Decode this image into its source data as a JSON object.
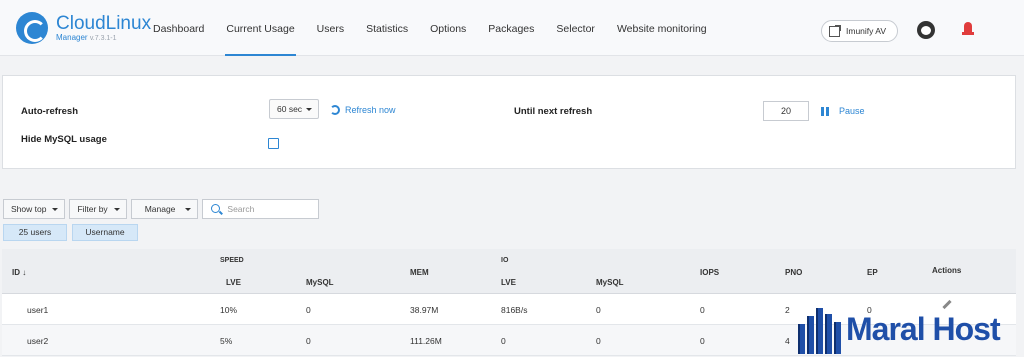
{
  "brand": {
    "name": "CloudLinux",
    "sub": "Manager",
    "version": "v.7.3.1-1"
  },
  "nav": [
    {
      "label": "Dashboard"
    },
    {
      "label": "Current Usage"
    },
    {
      "label": "Users"
    },
    {
      "label": "Statistics"
    },
    {
      "label": "Options"
    },
    {
      "label": "Packages"
    },
    {
      "label": "Selector"
    },
    {
      "label": "Website monitoring"
    }
  ],
  "header_actions": {
    "imunify": "Imunify AV"
  },
  "settings": {
    "auto_refresh_label": "Auto-refresh",
    "interval": "60 sec",
    "refresh_now": "Refresh now",
    "until_next_label": "Until next refresh",
    "countdown": "20",
    "pause": "Pause",
    "hide_mysql_label": "Hide MySQL usage"
  },
  "toolbar": {
    "show_top": "Show top",
    "filter_by": "Filter by",
    "manage": "Manage",
    "search_placeholder": "Search",
    "users_tag": "25 users",
    "username_tag": "Username"
  },
  "table": {
    "headers": {
      "id": "ID",
      "speed": "SPEED",
      "speed_lve": "LVE",
      "speed_mysql": "MySQL",
      "mem": "MEM",
      "io": "IO",
      "io_lve": "LVE",
      "io_mysql": "MySQL",
      "iops": "IOPS",
      "pno": "PNO",
      "ep": "EP",
      "actions": "Actions"
    },
    "rows": [
      {
        "id": "user1",
        "speed_lve": "10%",
        "speed_mysql": "0",
        "mem": "38.97M",
        "io_lve": "816B/s",
        "io_mysql": "0",
        "iops": "0",
        "pno": "2",
        "ep": "0"
      },
      {
        "id": "user2",
        "speed_lve": "5%",
        "speed_mysql": "0",
        "mem": "111.26M",
        "io_lve": "0",
        "io_mysql": "0",
        "iops": "0",
        "pno": "4",
        "ep": ""
      }
    ]
  },
  "watermark": {
    "text": "Maral Host"
  },
  "colors": {
    "accent": "#2d86d3",
    "alarm": "#e03c3c",
    "watermark": "#1f4fa8"
  }
}
